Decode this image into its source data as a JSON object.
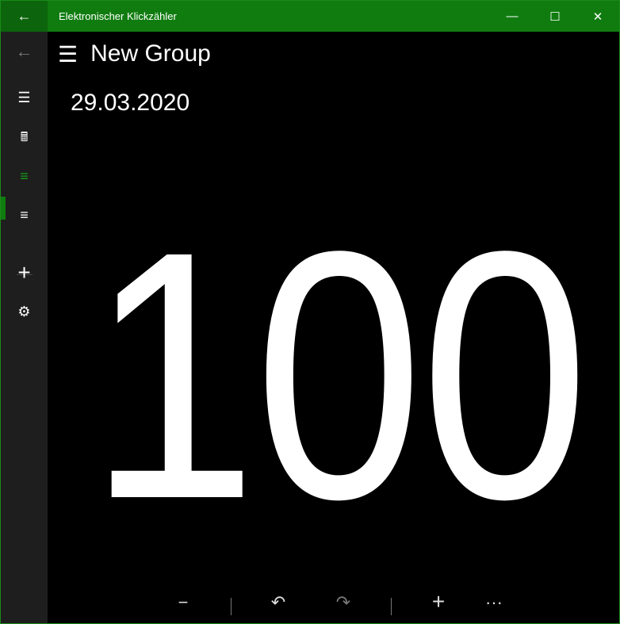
{
  "window": {
    "title": "Elektronischer Klickzähler",
    "back": "←",
    "minimize": "—",
    "maximize": "☐",
    "close": "✕"
  },
  "sidebar": {
    "items": [
      {
        "name": "back",
        "icon": "←"
      },
      {
        "name": "menu",
        "icon": "☰"
      },
      {
        "name": "calculator",
        "icon": "🖩"
      },
      {
        "name": "list-active",
        "icon": "≡"
      },
      {
        "name": "list",
        "icon": "≡"
      },
      {
        "name": "add",
        "icon": "+"
      },
      {
        "name": "settings",
        "icon": "⚙"
      }
    ]
  },
  "main": {
    "menu_icon": "☰",
    "group_title": "New Group",
    "date": "29.03.2020",
    "count": "100"
  },
  "commandbar": {
    "decrement": "−",
    "undo": "↶",
    "redo": "↷",
    "increment": "+",
    "more": "···"
  },
  "colors": {
    "accent": "#107c10"
  }
}
